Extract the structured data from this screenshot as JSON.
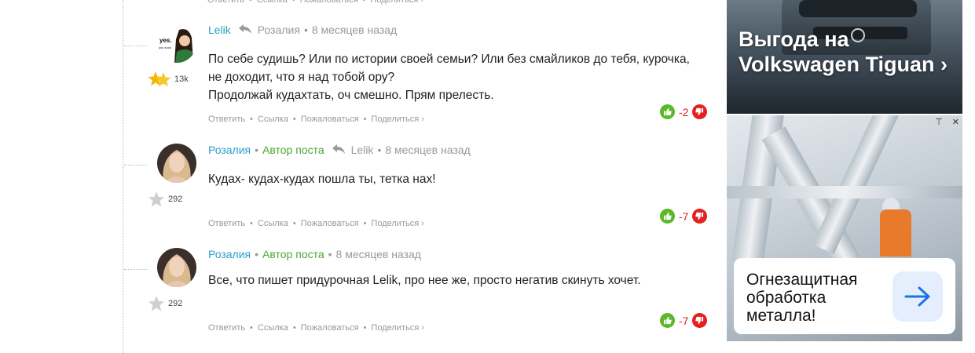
{
  "actions": {
    "reply": "Ответить",
    "link": "Ссылка",
    "complain": "Пожаловаться",
    "share": "Поделиться ›"
  },
  "comments": [
    {
      "author": "Lelik",
      "reply_to": "Розалия",
      "time": "8 месяцев назад",
      "rating": "13k",
      "avatar_caption": "yes.",
      "avatar_caption_small": "you suck",
      "text": [
        "По себе судишь? Или по истории своей семьи? Или без смайликов до тебя, курочка,",
        "не доходит, что я над тобой ору?",
        "Продолжай кудахтать, оч смешно. Прям прелесть."
      ],
      "score": "-2"
    },
    {
      "author": "Розалия",
      "badge": "Автор поста",
      "reply_to": "Lelik",
      "time": "8 месяцев назад",
      "rating": "292",
      "text": [
        "Кудах- кудах-кудах пошла ты, тетка нах!"
      ],
      "score": "-7"
    },
    {
      "author": "Розалия",
      "badge": "Автор поста",
      "time": "8 месяцев назад",
      "rating": "292",
      "text": [
        "Все, что пишет придурочная Lelik, про нее же, просто негатив скинуть хочет."
      ],
      "score": "-7"
    }
  ],
  "ads": {
    "top": {
      "headline": "Выгода на Volkswagen Tiguan ›"
    },
    "bottom": {
      "card_text": "Огнезащитная обработка металла!"
    }
  },
  "colors": {
    "author": "#2a9fc8",
    "badge": "#4aa832",
    "score": "#e02020",
    "vote_up": "#5cb82a",
    "vote_down": "#e42020"
  }
}
